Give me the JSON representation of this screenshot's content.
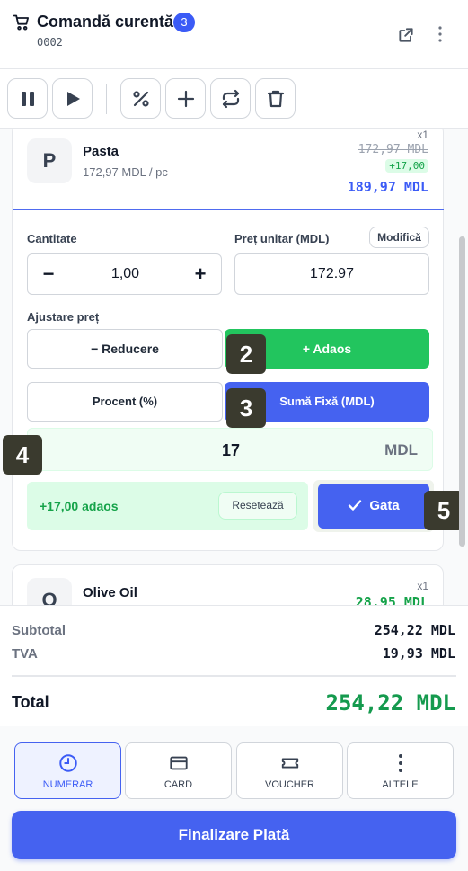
{
  "header": {
    "title": "Comandă curentă",
    "badge_count": "3",
    "order_number": "0002"
  },
  "toolbar": {
    "buttons": [
      "pause-icon",
      "play-icon",
      "percent-icon",
      "plus-icon",
      "swap-icon",
      "trash-icon"
    ]
  },
  "items": [
    {
      "initial": "P",
      "name": "Pasta",
      "unit_price": "172,97 MDL / pc",
      "quantity": "x1",
      "old_price": "172,97 MDL",
      "surcharge": "+17,00",
      "new_price": "189,97 MDL",
      "editor": {
        "quantity_label": "Cantitate",
        "quantity_value": "1,00",
        "minus": "−",
        "plus": "+",
        "unit_price_label": "Preț unitar (MDL)",
        "edit_button": "Modifică",
        "unit_price_value": "172.97",
        "adjust_label": "Ajustare preț",
        "discount_option": "− Reducere",
        "surcharge_option": "+ Adaos",
        "percent_option": "Procent (%)",
        "fixed_option": "Sumă Fixă (MDL)",
        "amount_value": "17",
        "amount_unit": "MDL",
        "summary": "+17,00 adaos",
        "reset_button": "Resetează",
        "done_button": "Gata"
      }
    },
    {
      "initial": "O",
      "name": "Olive Oil",
      "quantity": "x1",
      "price": "28,95 MDL"
    }
  ],
  "markers": [
    "2",
    "3",
    "4",
    "5"
  ],
  "totals": {
    "subtotal_label": "Subtotal",
    "subtotal_value": "254,22 MDL",
    "tax_label": "TVA",
    "tax_value": "19,93 MDL",
    "total_label": "Total",
    "total_value": "254,22 MDL"
  },
  "payment": {
    "methods": [
      {
        "label": "NUMERAR",
        "icon": "clock-icon",
        "selected": true
      },
      {
        "label": "CARD",
        "icon": "card-icon",
        "selected": false
      },
      {
        "label": "VOUCHER",
        "icon": "ticket-icon",
        "selected": false
      },
      {
        "label": "ALTELE",
        "icon": "more-vertical-icon",
        "selected": false
      }
    ],
    "finalize_button": "Finalizare Plată"
  },
  "colors": {
    "accent": "#4562f0",
    "success": "#22c55e",
    "total_green": "#159a4e"
  }
}
